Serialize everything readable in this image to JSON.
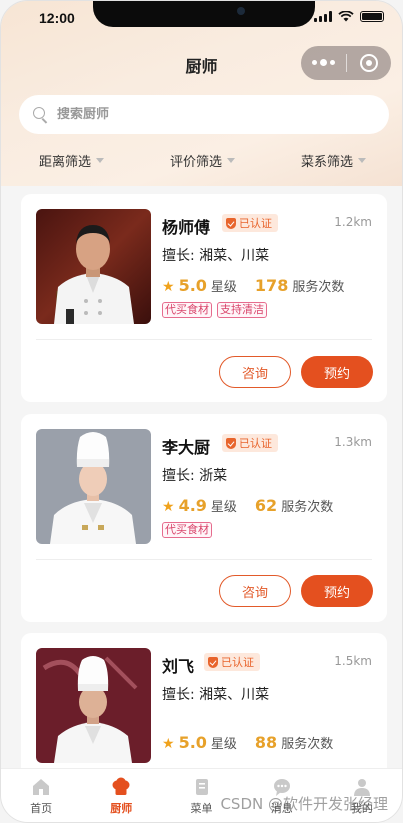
{
  "status_bar": {
    "time": "12:00"
  },
  "nav": {
    "title": "厨师"
  },
  "search": {
    "placeholder": "搜索厨师"
  },
  "filters": [
    {
      "label": "距离筛选"
    },
    {
      "label": "评价筛选"
    },
    {
      "label": "菜系筛选"
    }
  ],
  "chefs": [
    {
      "name": "杨师傅",
      "certified": "已认证",
      "distance": "1.2km",
      "specialty": "擅长: 湘菜、川菜",
      "rating": "5.0",
      "rating_unit": "星级",
      "services": "178",
      "services_unit": "服务次数",
      "tags": [
        "代买食材",
        "支持清洁"
      ],
      "consult_label": "咨询",
      "book_label": "预约"
    },
    {
      "name": "李大厨",
      "certified": "已认证",
      "distance": "1.3km",
      "specialty": "擅长: 浙菜",
      "rating": "4.9",
      "rating_unit": "星级",
      "services": "62",
      "services_unit": "服务次数",
      "tags": [
        "代买食材"
      ],
      "consult_label": "咨询",
      "book_label": "预约"
    },
    {
      "name": "刘飞",
      "certified": "已认证",
      "distance": "1.5km",
      "specialty": "擅长: 湘菜、川菜",
      "rating": "5.0",
      "rating_unit": "星级",
      "services": "88",
      "services_unit": "服务次数",
      "tags": []
    }
  ],
  "tabbar": [
    {
      "label": "首页",
      "icon": "home-icon",
      "active": false
    },
    {
      "label": "厨师",
      "icon": "chef-hat-icon",
      "active": true
    },
    {
      "label": "菜单",
      "icon": "menu-icon",
      "active": false
    },
    {
      "label": "消息",
      "icon": "message-icon",
      "active": false
    },
    {
      "label": "我的",
      "icon": "profile-icon",
      "active": false
    }
  ],
  "watermark": "CSDN @软件开发张经理",
  "colors": {
    "accent": "#e4501f",
    "rating": "#e7a12a",
    "tag": "#d9456b"
  }
}
